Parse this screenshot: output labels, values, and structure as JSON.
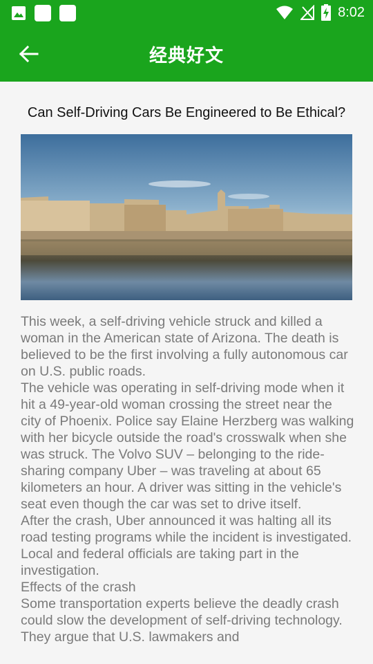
{
  "status_bar": {
    "time": "8:02"
  },
  "app_bar": {
    "title": "经典好文"
  },
  "article": {
    "title": "Can Self-Driving Cars Be Engineered to Be Ethical?",
    "paragraphs": [
      "This week, a self-driving vehicle struck and killed a woman in the American state of Arizona. The death is believed to be the first involving a fully autonomous car on U.S. public roads.",
      "The vehicle was operating in self-driving mode when it hit a 49-year-old woman crossing the street near the city of Phoenix. Police say Elaine Herzberg was walking with her bicycle outside the road's crosswalk when she was struck. The Volvo SUV – belonging to the ride-sharing company Uber – was traveling at about 65 kilometers an hour. A driver was sitting in the vehicle's seat even though the car was set to drive itself.",
      "After the crash, Uber announced it was halting all its road testing programs while the incident is investigated. Local and federal officials are taking part in the investigation.",
      "Effects of the crash",
      "Some transportation experts believe the deadly crash could slow the development of self-driving technology. They argue that U.S. lawmakers and"
    ]
  },
  "colors": {
    "primary": "#1aa51d",
    "body_text": "#7a7a7a"
  }
}
